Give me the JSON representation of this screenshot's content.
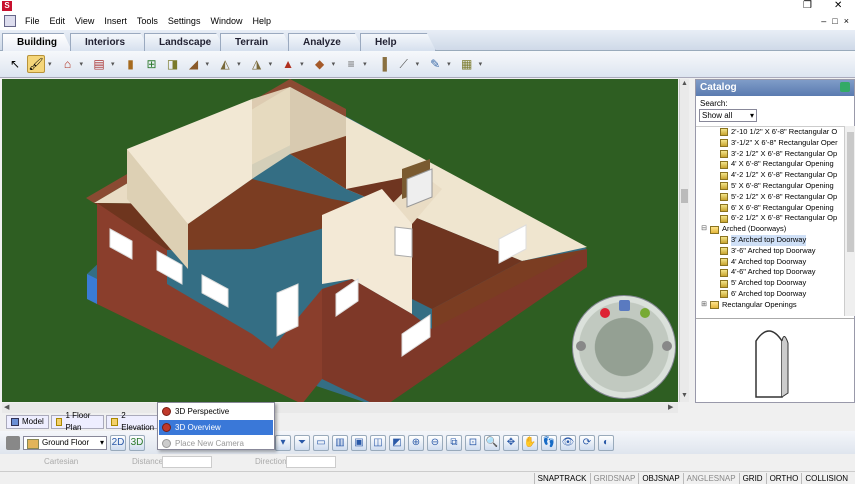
{
  "window": {
    "logo_letter": "S",
    "restore": "❐",
    "close": "✕"
  },
  "menu": {
    "items": [
      "File",
      "Edit",
      "View",
      "Insert",
      "Tools",
      "Settings",
      "Window",
      "Help"
    ],
    "right_controls": [
      "–",
      "□",
      "×"
    ]
  },
  "ribbon_tabs": [
    "Building",
    "Interiors",
    "Landscape",
    "Terrain",
    "Analyze",
    "Help"
  ],
  "active_tab": "Building",
  "catalog": {
    "title": "Catalog",
    "search_label": "Search:",
    "filter_value": "Show all",
    "items": [
      "2'-10 1/2\" X 6'-8\" Rectangular O",
      "3'-1/2\" X 6'-8\" Rectangular Oper",
      "3'-2 1/2\" X 6'-8\" Rectangular Op",
      "4' X 6'-8\" Rectangular Opening",
      "4'-2 1/2\" X 6'-8\" Rectangular Op",
      "5' X 6'-8\" Rectangular Opening",
      "5'-2 1/2\" X 6'-8\" Rectangular Op",
      "6' X 6'-8\" Rectangular Opening",
      "6'-2 1/2\" X 6'-8\" Rectangular Op"
    ],
    "folder_arched": "Arched (Doorways)",
    "arched_items": [
      "3' Arched top Doorway",
      "3'-6\" Arched top Doorway",
      "4' Arched top Doorway",
      "4'-6\" Arched top Doorway",
      "5' Arched top Doorway",
      "6' Arched top Doorway"
    ],
    "folder_rect": "Rectangular Openings"
  },
  "view_tabs": [
    "Model",
    "1 Floor Plan",
    "2 Elevation"
  ],
  "camera_menu": {
    "items": [
      "3D Perspective",
      "3D Overview",
      "Place New Camera"
    ],
    "active": "3D Overview"
  },
  "floor_select": "Ground Floor",
  "bottom_buttons": [
    "2D",
    "3D"
  ],
  "coords": {
    "system": "Cartesian",
    "distance_label": "Distance",
    "direction_label": "Direction"
  },
  "status": [
    "SNAPTRACK",
    "GRIDSNAP",
    "OBJSNAP",
    "ANGLESNAP",
    "GRID",
    "ORTHO",
    "COLLISION"
  ],
  "status_off": [
    "GRIDSNAP",
    "ANGLESNAP"
  ],
  "colors": {
    "ground": "#2e5e22",
    "brick": "#7a3a2a",
    "floor": "#7b3d22",
    "wall": "#efe6d4",
    "accent": "#3a78d8"
  }
}
